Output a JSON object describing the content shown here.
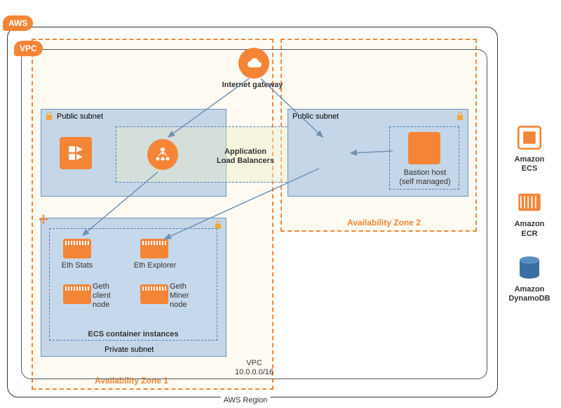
{
  "tags": {
    "aws": "AWS",
    "vpc": "VPC"
  },
  "region_label": "AWS Region",
  "vpc_label_line1": "VPC",
  "vpc_label_line2": "10.0.0.0/16",
  "igw": "Internet gateway",
  "alb": "Application\nLoad Balancers",
  "az1": "Availability Zone 1",
  "az2": "Availability Zone 2",
  "public_subnet": "Public subnet",
  "private_subnet": "Private subnet",
  "bastion_line1": "Bastion host",
  "bastion_line2": "(self managed)",
  "ecs_group": "ECS container instances",
  "nodes": {
    "eth_stats": "Eth Stats",
    "eth_explorer": "Eth Explorer",
    "geth_client_l1": "Geth",
    "geth_client_l2": "client",
    "geth_client_l3": "node",
    "geth_miner_l1": "Geth",
    "geth_miner_l2": "Miner",
    "geth_miner_l3": "node"
  },
  "services": {
    "ecs_l1": "Amazon",
    "ecs_l2": "ECS",
    "ecr_l1": "Amazon",
    "ecr_l2": "ECR",
    "ddb_l1": "Amazon",
    "ddb_l2": "DynamoDB"
  },
  "colors": {
    "orange": "#f58536",
    "subnet": "#c5d6e8",
    "blue": "#3b6fa3"
  }
}
